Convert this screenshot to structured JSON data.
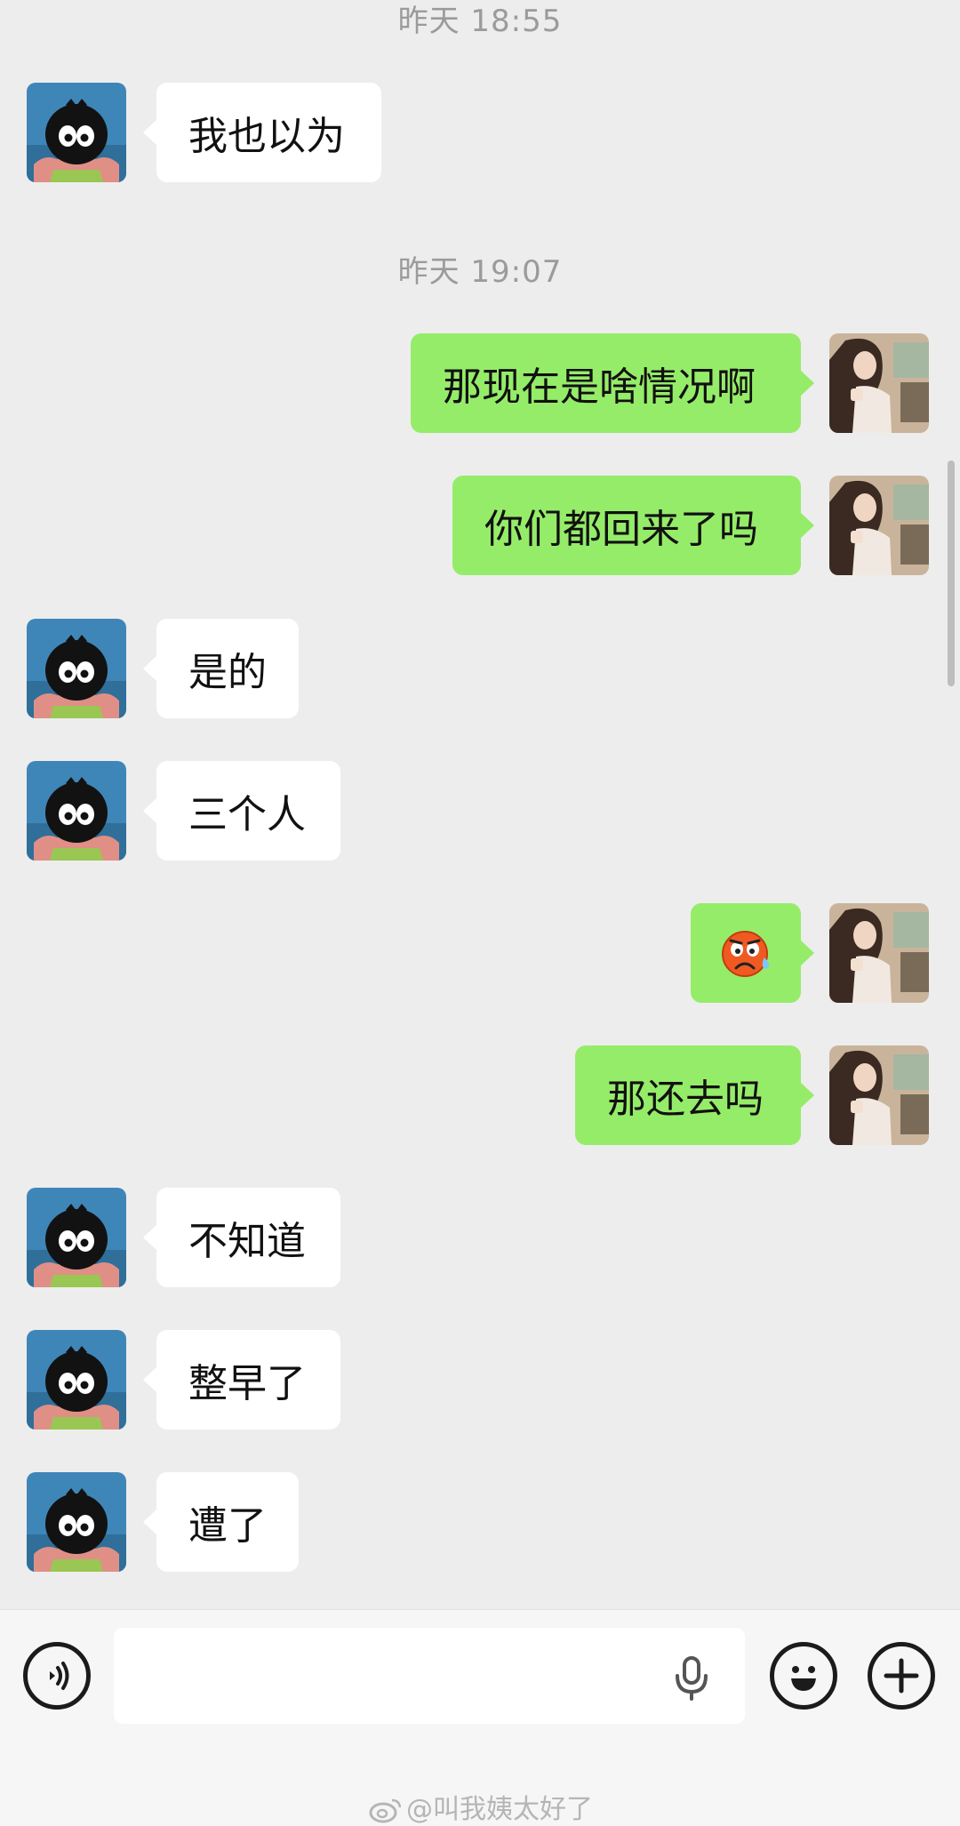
{
  "timestamps": [
    "昨天 18:55",
    "昨天 19:07"
  ],
  "messages": [
    {
      "side": "in",
      "text": "我也以为"
    },
    {
      "side": "out",
      "text": "那现在是啥情况啊"
    },
    {
      "side": "out",
      "text": "你们都回来了吗"
    },
    {
      "side": "in",
      "text": "是的"
    },
    {
      "side": "in",
      "text": "三个人"
    },
    {
      "side": "out",
      "emoji": "frown-sweat-emoji"
    },
    {
      "side": "out",
      "text": "那还去吗"
    },
    {
      "side": "in",
      "text": "不知道"
    },
    {
      "side": "in",
      "text": "整早了"
    },
    {
      "side": "in",
      "text": "遭了"
    }
  ],
  "input": {
    "voice_icon": "voice-icon",
    "mic_icon": "microphone-icon",
    "emoji_icon": "smiley-icon",
    "more_icon": "plus-icon"
  },
  "watermark": {
    "text": "@叫我姨太好了",
    "icon": "weibo-icon"
  },
  "colors": {
    "background": "#ededed",
    "incoming_bubble": "#ffffff",
    "outgoing_bubble": "#95ec69"
  }
}
